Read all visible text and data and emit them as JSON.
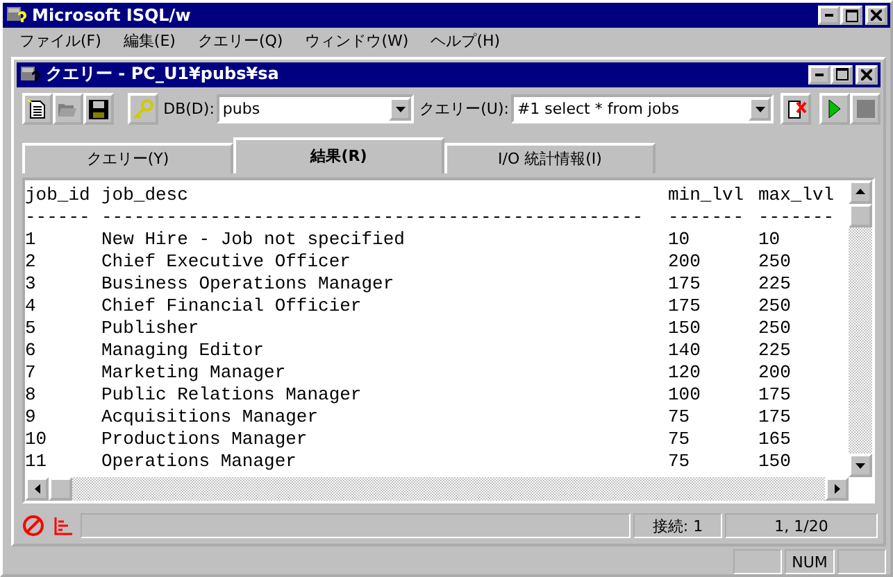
{
  "window": {
    "title": "Microsoft ISQL/w"
  },
  "menu": [
    "ファイル(F)",
    "編集(E)",
    "クエリー(Q)",
    "ウィンドウ(W)",
    "ヘルプ(H)"
  ],
  "child": {
    "title": "クエリー - PC_U1¥pubs¥sa",
    "toolbar": {
      "db_label": "DB(D):",
      "db_value": "pubs",
      "query_label": "クエリー(U):",
      "query_value": "#1 select * from jobs"
    },
    "tabs": [
      {
        "label": "クエリー(Y)",
        "selected": false
      },
      {
        "label": "結果(R)",
        "selected": true
      },
      {
        "label": "I/O 統計情報(I)",
        "selected": false
      }
    ],
    "results": {
      "columns": [
        {
          "name": "job_id",
          "rule": "------"
        },
        {
          "name": "job_desc",
          "rule": "--------------------------------------------------"
        },
        {
          "name": "min_lvl",
          "rule": "-------"
        },
        {
          "name": "max_lvl",
          "rule": "-------"
        }
      ],
      "rows": [
        [
          "1",
          "New Hire - Job not specified",
          "10",
          "10"
        ],
        [
          "2",
          "Chief Executive Officer",
          "200",
          "250"
        ],
        [
          "3",
          "Business Operations Manager",
          "175",
          "225"
        ],
        [
          "4",
          "Chief Financial Officier",
          "175",
          "250"
        ],
        [
          "5",
          "Publisher",
          "150",
          "250"
        ],
        [
          "6",
          "Managing Editor",
          "140",
          "225"
        ],
        [
          "7",
          "Marketing Manager",
          "120",
          "200"
        ],
        [
          "8",
          "Public Relations Manager",
          "100",
          "175"
        ],
        [
          "9",
          "Acquisitions Manager",
          "75",
          "175"
        ],
        [
          "10",
          "Productions Manager",
          "75",
          "165"
        ],
        [
          "11",
          "Operations Manager",
          "75",
          "150"
        ]
      ]
    },
    "status": {
      "connection": "接続: 1",
      "position": "1, 1/20"
    }
  },
  "status_bar": {
    "num": "NUM"
  }
}
